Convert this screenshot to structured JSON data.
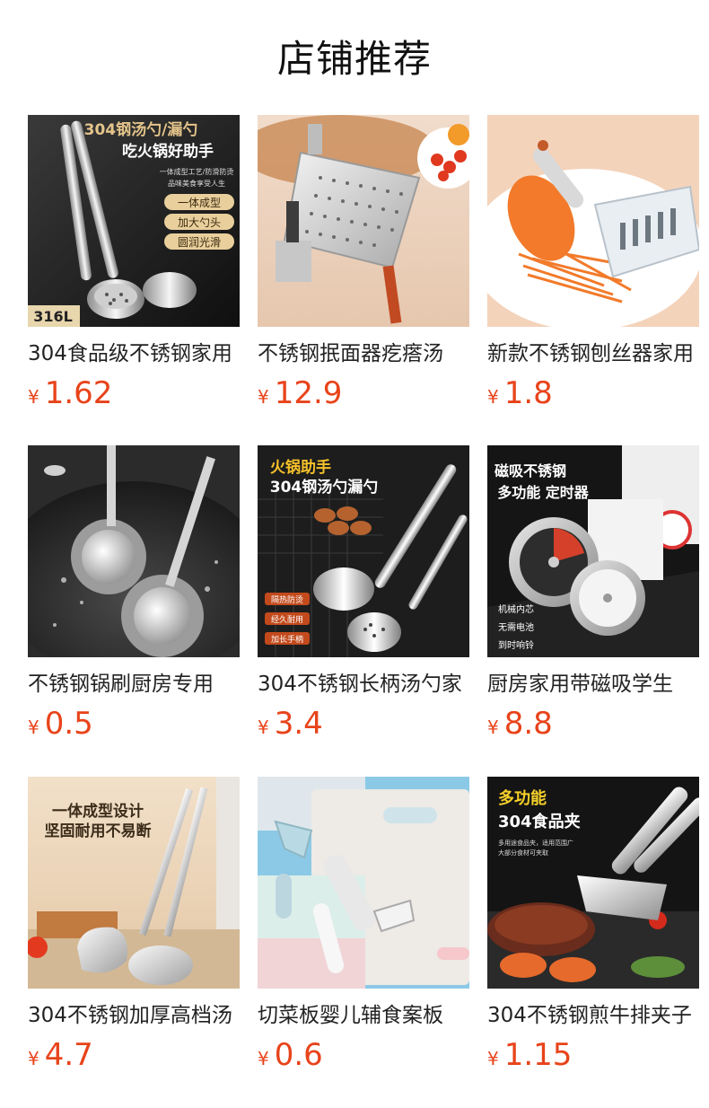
{
  "page": {
    "title": "店铺推荐"
  },
  "currency": "¥",
  "colors": {
    "price": "#e8431a",
    "title": "#111111",
    "name": "#222222"
  },
  "products": [
    {
      "name": "304食品级不锈钢家用",
      "price": "1.62",
      "image_text": {
        "headline1": "304钢汤勺/漏勺",
        "headline2": "吃火锅好助手",
        "sub1": "一体成型工艺/防滑防烫",
        "sub2": "品味美食享受人生",
        "tag1": "一体成型",
        "tag2": "加大勺头",
        "tag3": "圆润光滑",
        "badge": "316L"
      }
    },
    {
      "name": "不锈钢抿面器疙瘩汤",
      "price": "12.9",
      "image_text": {}
    },
    {
      "name": "新款不锈钢刨丝器家用",
      "price": "1.8",
      "image_text": {}
    },
    {
      "name": "不锈钢锅刷厨房专用",
      "price": "0.5",
      "image_text": {}
    },
    {
      "name": "304不锈钢长柄汤勺家",
      "price": "3.4",
      "image_text": {
        "headline1": "火锅助手",
        "headline2": "304钢汤勺漏勺",
        "tag1": "隔热防烫",
        "tag2": "经久耐用",
        "tag3": "加长手柄"
      }
    },
    {
      "name": "厨房家用带磁吸学生",
      "price": "8.8",
      "image_text": {
        "headline1": "磁吸不锈钢",
        "headline2": "多功能 定时器",
        "check1": "机械内芯",
        "check2": "无需电池",
        "check3": "到时响铃"
      }
    },
    {
      "name": "304不锈钢加厚高档汤",
      "price": "4.7",
      "image_text": {
        "headline1": "一体成型设计",
        "headline2": "坚固耐用不易断"
      }
    },
    {
      "name": "切菜板婴儿辅食案板",
      "price": "0.6",
      "image_text": {}
    },
    {
      "name": "304不锈钢煎牛排夹子",
      "price": "1.15",
      "image_text": {
        "headline1": "多功能",
        "headline2": "304食品夹",
        "sub1": "多用途食品夹，适用范围广",
        "sub2": "大部分食材可夹取"
      }
    }
  ]
}
